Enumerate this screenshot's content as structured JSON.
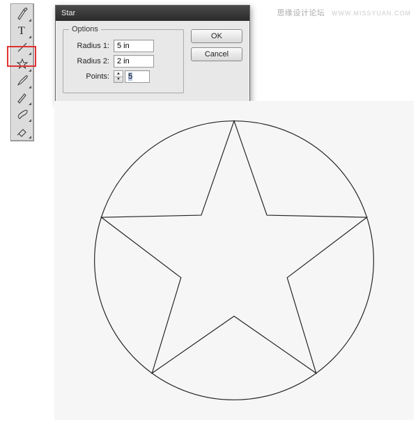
{
  "watermark": {
    "cn": "思缘设计论坛",
    "url": "WWW.MISSYUAN.COM"
  },
  "toolbar": {
    "tools": [
      {
        "name": "pen-tool"
      },
      {
        "name": "type-tool"
      },
      {
        "name": "line-segment-tool"
      },
      {
        "name": "star-tool",
        "selected": true
      },
      {
        "name": "paintbrush-tool"
      },
      {
        "name": "pencil-tool"
      },
      {
        "name": "blob-brush-tool"
      },
      {
        "name": "eraser-tool"
      }
    ]
  },
  "dialog": {
    "title": "Star",
    "options_legend": "Options",
    "radius1_label": "Radius 1:",
    "radius1_value": "5 in",
    "radius2_label": "Radius 2:",
    "radius2_value": "2 in",
    "points_label": "Points:",
    "points_value": "5",
    "ok_label": "OK",
    "cancel_label": "Cancel"
  },
  "chart_data": {
    "type": "diagram",
    "description": "Circle with inscribed 5-point star",
    "circle_radius_in": 5,
    "star_outer_radius_in": 5,
    "star_inner_radius_in": 2,
    "star_points": 5
  }
}
